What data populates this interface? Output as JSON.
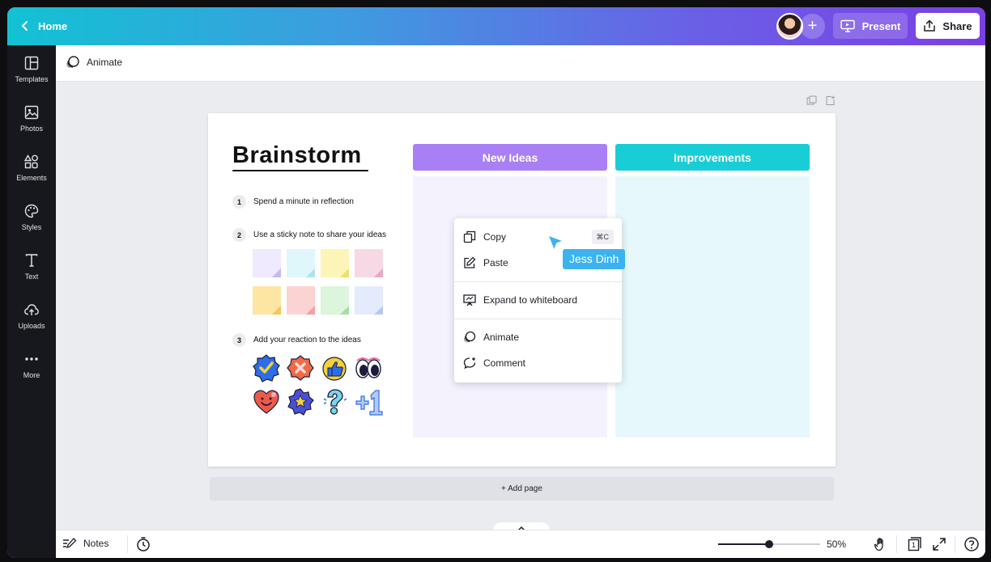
{
  "header": {
    "home_label": "Home",
    "present_label": "Present",
    "share_label": "Share"
  },
  "sidebar": {
    "items": [
      {
        "label": "Templates",
        "icon": "templates-icon"
      },
      {
        "label": "Photos",
        "icon": "photos-icon"
      },
      {
        "label": "Elements",
        "icon": "elements-icon"
      },
      {
        "label": "Styles",
        "icon": "styles-icon"
      },
      {
        "label": "Text",
        "icon": "text-icon"
      },
      {
        "label": "Uploads",
        "icon": "uploads-icon"
      },
      {
        "label": "More",
        "icon": "more-icon"
      }
    ]
  },
  "toolbar": {
    "animate_label": "Animate"
  },
  "board": {
    "title": "Brainstorm",
    "steps": [
      {
        "num": "1",
        "text": "Spend a minute in reflection"
      },
      {
        "num": "2",
        "text": "Use a sticky note to share your ideas"
      },
      {
        "num": "3",
        "text": "Add your reaction to the ideas"
      }
    ],
    "sticky_colors": [
      "#efeafd",
      "#dff6fb",
      "#fdf4b8",
      "#f7d9e6",
      "#fde5a4",
      "#fcd3d3",
      "#dcf5dc",
      "#e3ebfc"
    ],
    "sticky_fold_colors": [
      "#c8b9f5",
      "#aee3f0",
      "#f0df6b",
      "#e9a9c4",
      "#f4c65c",
      "#f3a1a1",
      "#a6dfa6",
      "#b7c9f3"
    ],
    "columns": [
      {
        "label": "New Ideas",
        "head_color": "#a87ff5",
        "body_color": "#f4f2fd"
      },
      {
        "label": "Improvements",
        "head_color": "#19cdd6",
        "body_color": "#e6f8fb"
      }
    ]
  },
  "context_menu": {
    "items": [
      {
        "label": "Copy",
        "shortcut": "⌘C",
        "icon": "copy-icon"
      },
      {
        "label": "Paste",
        "icon": "paste-icon"
      },
      {
        "label": "Expand to whiteboard",
        "icon": "whiteboard-icon"
      },
      {
        "label": "Animate",
        "icon": "animate-icon"
      },
      {
        "label": "Comment",
        "icon": "comment-icon"
      }
    ]
  },
  "collaborator": {
    "name": "Jess Dinh",
    "color": "#3cb3f1"
  },
  "add_page_label": "+ Add page",
  "footer": {
    "notes_label": "Notes",
    "zoom_label": "50%",
    "zoom_fraction": 0.5,
    "page_number": "1"
  }
}
